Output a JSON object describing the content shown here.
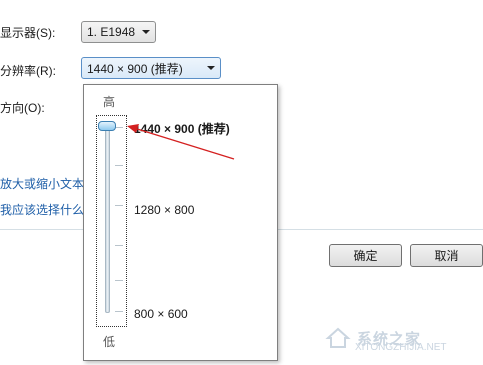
{
  "form": {
    "display_label": "显示器(S):",
    "display_value": "1. E1948",
    "resolution_label": "分辨率(R):",
    "resolution_value": "1440 × 900 (推荐)",
    "orientation_label": "方向(O):"
  },
  "links": {
    "enlarge": "放大或缩小文本",
    "which": "我应该选择什么"
  },
  "buttons": {
    "ok": "确定",
    "cancel": "取消"
  },
  "resolution_popup": {
    "high_label": "高",
    "low_label": "低",
    "options": [
      {
        "label": "1440 × 900 (推荐)",
        "selected": true
      },
      {
        "label": "1280 × 800",
        "selected": false
      },
      {
        "label": "800 × 600",
        "selected": false
      }
    ],
    "slider_level": 1.0
  },
  "watermark": {
    "text": "系统之家",
    "url": "XITONGZHIJIA.NET"
  },
  "colors": {
    "annotation_arrow": "#d42020",
    "link": "#1f5fa8"
  }
}
